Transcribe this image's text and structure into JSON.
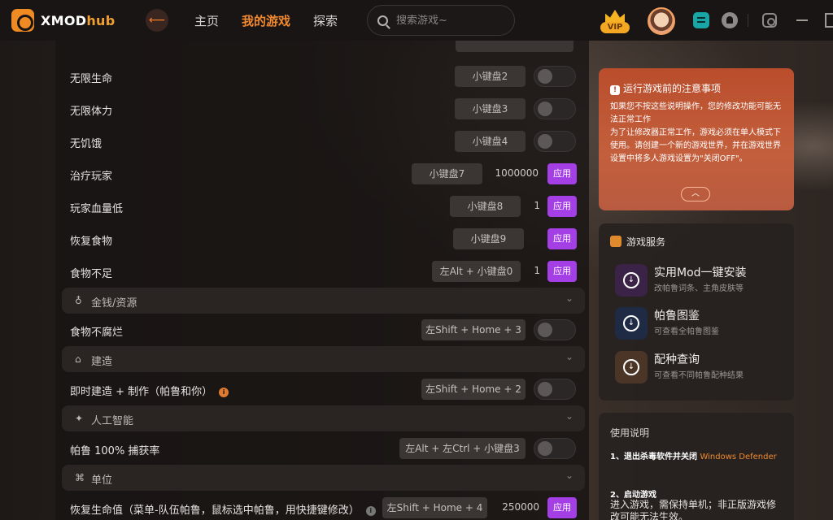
{
  "header": {
    "logo_text": "XMOD",
    "logo_hub": "hub",
    "back_icon": "arrow-left",
    "nav": [
      "主页",
      "我的游戏",
      "探索"
    ],
    "active_nav": "我的游戏",
    "search_placeholder": "搜索游戏~",
    "vip_label": "VIP",
    "accent": "#f0892f"
  },
  "rows": {
    "r1": {
      "label": "无限生命",
      "key": "小键盘2"
    },
    "r2": {
      "label": "无限体力",
      "key": "小键盘3"
    },
    "r3": {
      "label": "无饥饿",
      "key": "小键盘4"
    },
    "r4": {
      "label": "治疗玩家",
      "key": "小键盘7",
      "value": "1000000",
      "apply": "应用"
    },
    "r5": {
      "label": "玩家血量低",
      "key": "小键盘8",
      "value": "1",
      "apply": "应用"
    },
    "r6": {
      "label": "恢复食物",
      "key": "小键盘9",
      "apply": "应用"
    },
    "r7": {
      "label": "食物不足",
      "key": "左Alt + 小键盘0",
      "value": "1",
      "apply": "应用"
    },
    "r8": {
      "label": "食物不腐烂",
      "key": "左Shift + Home + 3"
    },
    "r9": {
      "label": "即时建造 + 制作（帕鲁和你）",
      "key": "左Shift + Home + 2"
    },
    "r10": {
      "label": "帕鲁 100% 捕获率",
      "key": "左Alt + 左Ctrl + 小键盘3"
    },
    "r11": {
      "label": "恢复生命值（菜单-队伍帕鲁，鼠标选中帕鲁，用快捷键修改）",
      "key": "左Shift + Home + 4",
      "value": "250000",
      "apply": "应用"
    }
  },
  "categories": {
    "c1": {
      "label": "金钱/资源",
      "icon": "money-bag-icon"
    },
    "c2": {
      "label": "建造",
      "icon": "building-icon"
    },
    "c3": {
      "label": "人工智能",
      "icon": "ai-icon"
    },
    "c4": {
      "label": "单位",
      "icon": "unit-icon"
    }
  },
  "notice": {
    "title": "运行游戏前的注意事项",
    "body": "如果您不按这些说明操作，您的修改功能可能无法正常工作\n为了让修改器正常工作，游戏必须在单人模式下使用。请创建一个新的游戏世界，并在游戏世界设置中将多人游戏设置为\"关闭OFF\"。",
    "color": "#c35f3c"
  },
  "services": {
    "title": "游戏服务",
    "items": [
      {
        "name": "实用Mod一键安装",
        "desc": "改帕鲁词条、主角皮肤等",
        "color": "#3a2347"
      },
      {
        "name": "帕鲁图鉴",
        "desc": "可查看全帕鲁图鉴",
        "color": "#1f2a44"
      },
      {
        "name": "配种查询",
        "desc": "可查看不同帕鲁配种结果",
        "color": "#4a3527"
      }
    ]
  },
  "usage": {
    "title": "使用说明",
    "step1_prefix": "1、退出杀毒软件并关闭 ",
    "step1_link": "Windows Defender",
    "step2": "2、启动游戏",
    "step2_text": "进入游戏，需保持单机；非正版游戏修改可能无法生效。"
  }
}
